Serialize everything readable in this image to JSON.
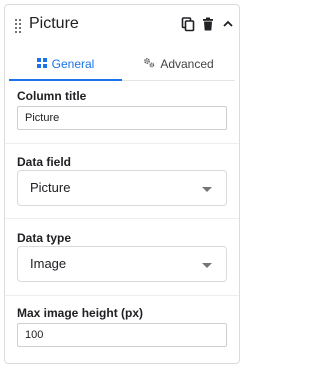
{
  "header": {
    "title": "Picture",
    "icons": [
      "drag-handle-icon",
      "copy-icon",
      "delete-icon",
      "chevron-up-icon"
    ]
  },
  "tabs": [
    {
      "label": "General",
      "icon": "grid-icon",
      "active": true
    },
    {
      "label": "Advanced",
      "icon": "gears-icon",
      "active": false
    }
  ],
  "fields": {
    "column_title": {
      "label": "Column title",
      "value": "Picture"
    },
    "data_field": {
      "label": "Data field",
      "value": "Picture"
    },
    "data_type": {
      "label": "Data type",
      "value": "Image"
    },
    "max_image_height": {
      "label": "Max image height (px)",
      "value": "100"
    }
  },
  "colors": {
    "accent": "#1a73e8",
    "border": "#dcdcdc",
    "text": "#202124"
  }
}
